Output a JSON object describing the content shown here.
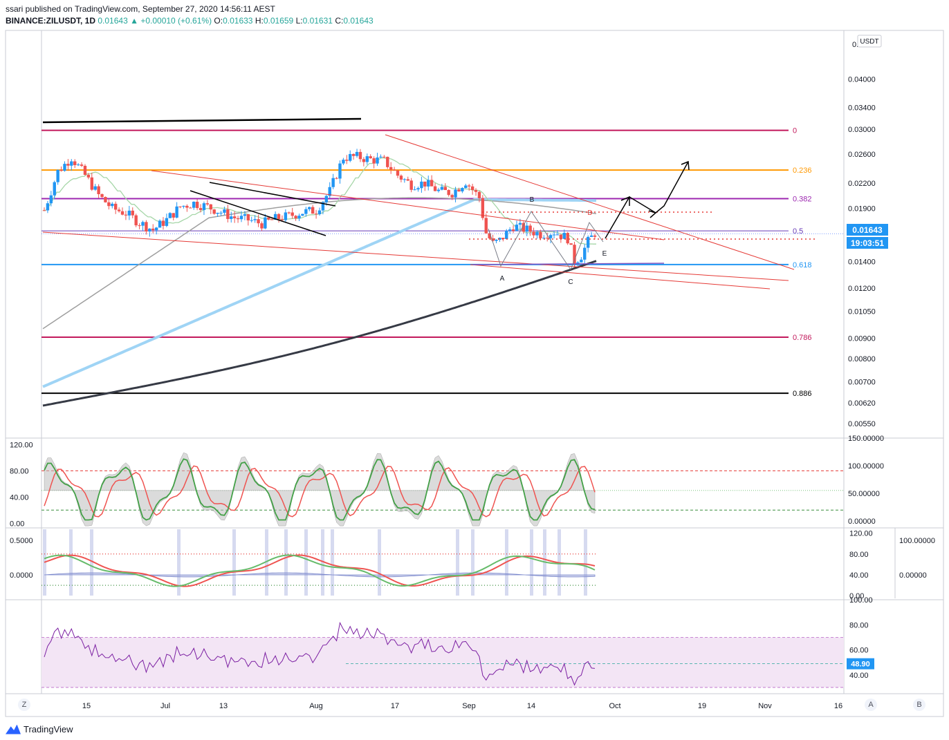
{
  "header": {
    "published": "ssari published on TradingView.com, September 27, 2020 14:56:11 AEST",
    "symbol": "BINANCE:ZILUSDT, 1D",
    "last": "0.01643",
    "change": "+0.00010 (+0.61%)",
    "o_label": "O:",
    "o": "0.01633",
    "h_label": "H:",
    "h": "0.01659",
    "l_label": "L:",
    "l": "0.01631",
    "c_label": "C:",
    "c": "0.01643"
  },
  "colors": {
    "up": "#2196f3",
    "down": "#ef5350",
    "fib0": "#c2185b",
    "fib236": "#ff9800",
    "fib382": "#9c27b0",
    "fib5": "#673ab7",
    "fib618": "#2196f3",
    "fib786": "#c2185b",
    "fib886": "#000000",
    "ma200": "#363a45",
    "ma100": "#9fd4f5",
    "ma50": "#9e9e9e",
    "ma20": "#a5d6a7",
    "rsi": "#7b1fa2",
    "trend": "#e53935"
  },
  "chart_data": [
    {
      "type": "candlestick",
      "title": "BINANCE:ZILUSDT, 1D",
      "currency": "USDT",
      "scale": "log",
      "ylim": [
        0.0051,
        0.053
      ],
      "y_ticks": [
        "0.04000",
        "0.03400",
        "0.03000",
        "0.02600",
        "0.02200",
        "0.01900",
        "0.01400",
        "0.01200",
        "0.01050",
        "0.00900",
        "0.00800",
        "0.00700",
        "0.00620",
        "0.00550"
      ],
      "x_ticks": [
        "15",
        "Jul",
        "13",
        "Aug",
        "17",
        "Sep",
        "14",
        "Oct",
        "19",
        "Nov",
        "16"
      ],
      "last_price_label": "0.01643",
      "countdown_label": "19:03:51",
      "fib_levels": [
        {
          "label": "0",
          "price": 0.0298
        },
        {
          "label": "0.236",
          "price": 0.0237
        },
        {
          "label": "0.382",
          "price": 0.0201
        },
        {
          "label": "0.5",
          "price": 0.0167
        },
        {
          "label": "0.618",
          "price": 0.01375
        },
        {
          "label": "0.786",
          "price": 0.00905
        },
        {
          "label": "0.886",
          "price": 0.00655
        }
      ],
      "pattern_labels": [
        "A",
        "B",
        "C",
        "D",
        "E"
      ]
    },
    {
      "type": "line",
      "title": "",
      "left_ticks": [
        "120.00",
        "80.00",
        "40.00",
        "0.00"
      ],
      "right_ticks": [
        "150.00000",
        "100.00000",
        "50.00000",
        "0.00000"
      ],
      "ylim": [
        -5,
        130
      ],
      "levels": [
        80,
        50,
        20
      ]
    },
    {
      "type": "line",
      "title": "",
      "left_ticks": [
        "0.5000",
        "0.0000"
      ],
      "mid_ticks": [
        "120.00",
        "80.00",
        "40.00",
        "0.00"
      ],
      "right_ticks": [
        "100.00000",
        "0.00000"
      ],
      "ylim": [
        -5,
        130
      ],
      "levels": [
        80,
        20
      ]
    },
    {
      "type": "line",
      "title": "",
      "right_ticks": [
        "100.00",
        "80.00",
        "60.00",
        "48.90",
        "40.00"
      ],
      "ylim": [
        25,
        100
      ],
      "band": [
        30,
        70
      ],
      "current_label": "48.90",
      "current": 48.9
    }
  ],
  "axis_buttons": {
    "z": "Z",
    "a": "A",
    "b": "B"
  },
  "footer": {
    "brand": "TradingView"
  }
}
